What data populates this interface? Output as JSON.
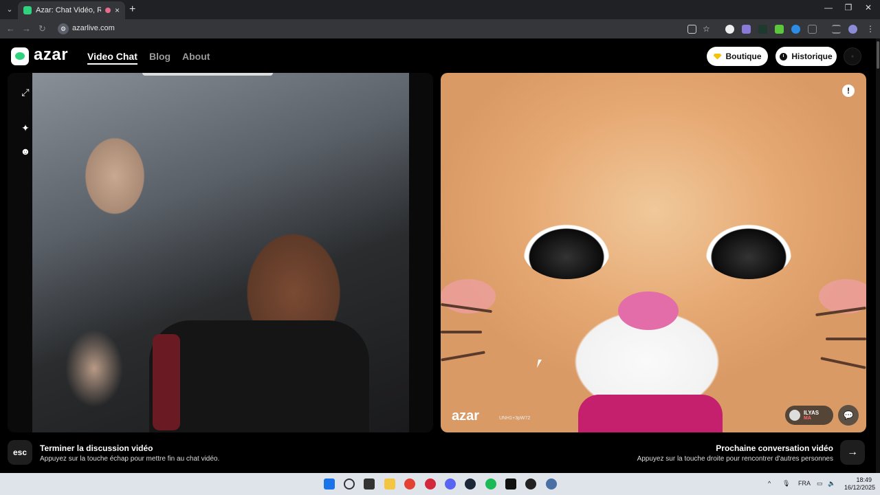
{
  "browser": {
    "tab_title": "Azar: Chat Vidéo, Rencontre",
    "url": "azarlive.com",
    "tab_menu_icon": "chevron-down-icon",
    "new_tab_icon": "+",
    "close_tab_icon": "×",
    "minimize": "—",
    "maximize": "❐",
    "close": "✕",
    "back": "←",
    "forward": "→",
    "reload": "↻"
  },
  "site": {
    "logo": "azar",
    "nav": [
      {
        "label": "Video Chat"
      },
      {
        "label": "Blog"
      },
      {
        "label": "About"
      }
    ],
    "boutique_label": "Boutique",
    "historique_label": "Historique"
  },
  "video": {
    "watermark": "azar",
    "watermark_code": "UNH1+3pW72",
    "partner_name": "ILYAS",
    "partner_country": "MA",
    "alert_icon": "!",
    "chat_icon": "💬",
    "side_icons": [
      "⤢",
      "✦",
      "☻"
    ]
  },
  "bottom": {
    "esc_key": "esc",
    "end_title": "Terminer la discussion vidéo",
    "end_sub": "Appuyez sur la touche échap pour mettre fin au chat vidéo.",
    "next_title": "Prochaine conversation vidéo",
    "next_sub": "Appuyez sur la touche droite pour rencontrer d'autres personnes",
    "next_icon": "→"
  },
  "taskbar": {
    "language": "FRA",
    "time": "18:49",
    "date": "16/12/2025",
    "tray_up": "^"
  }
}
